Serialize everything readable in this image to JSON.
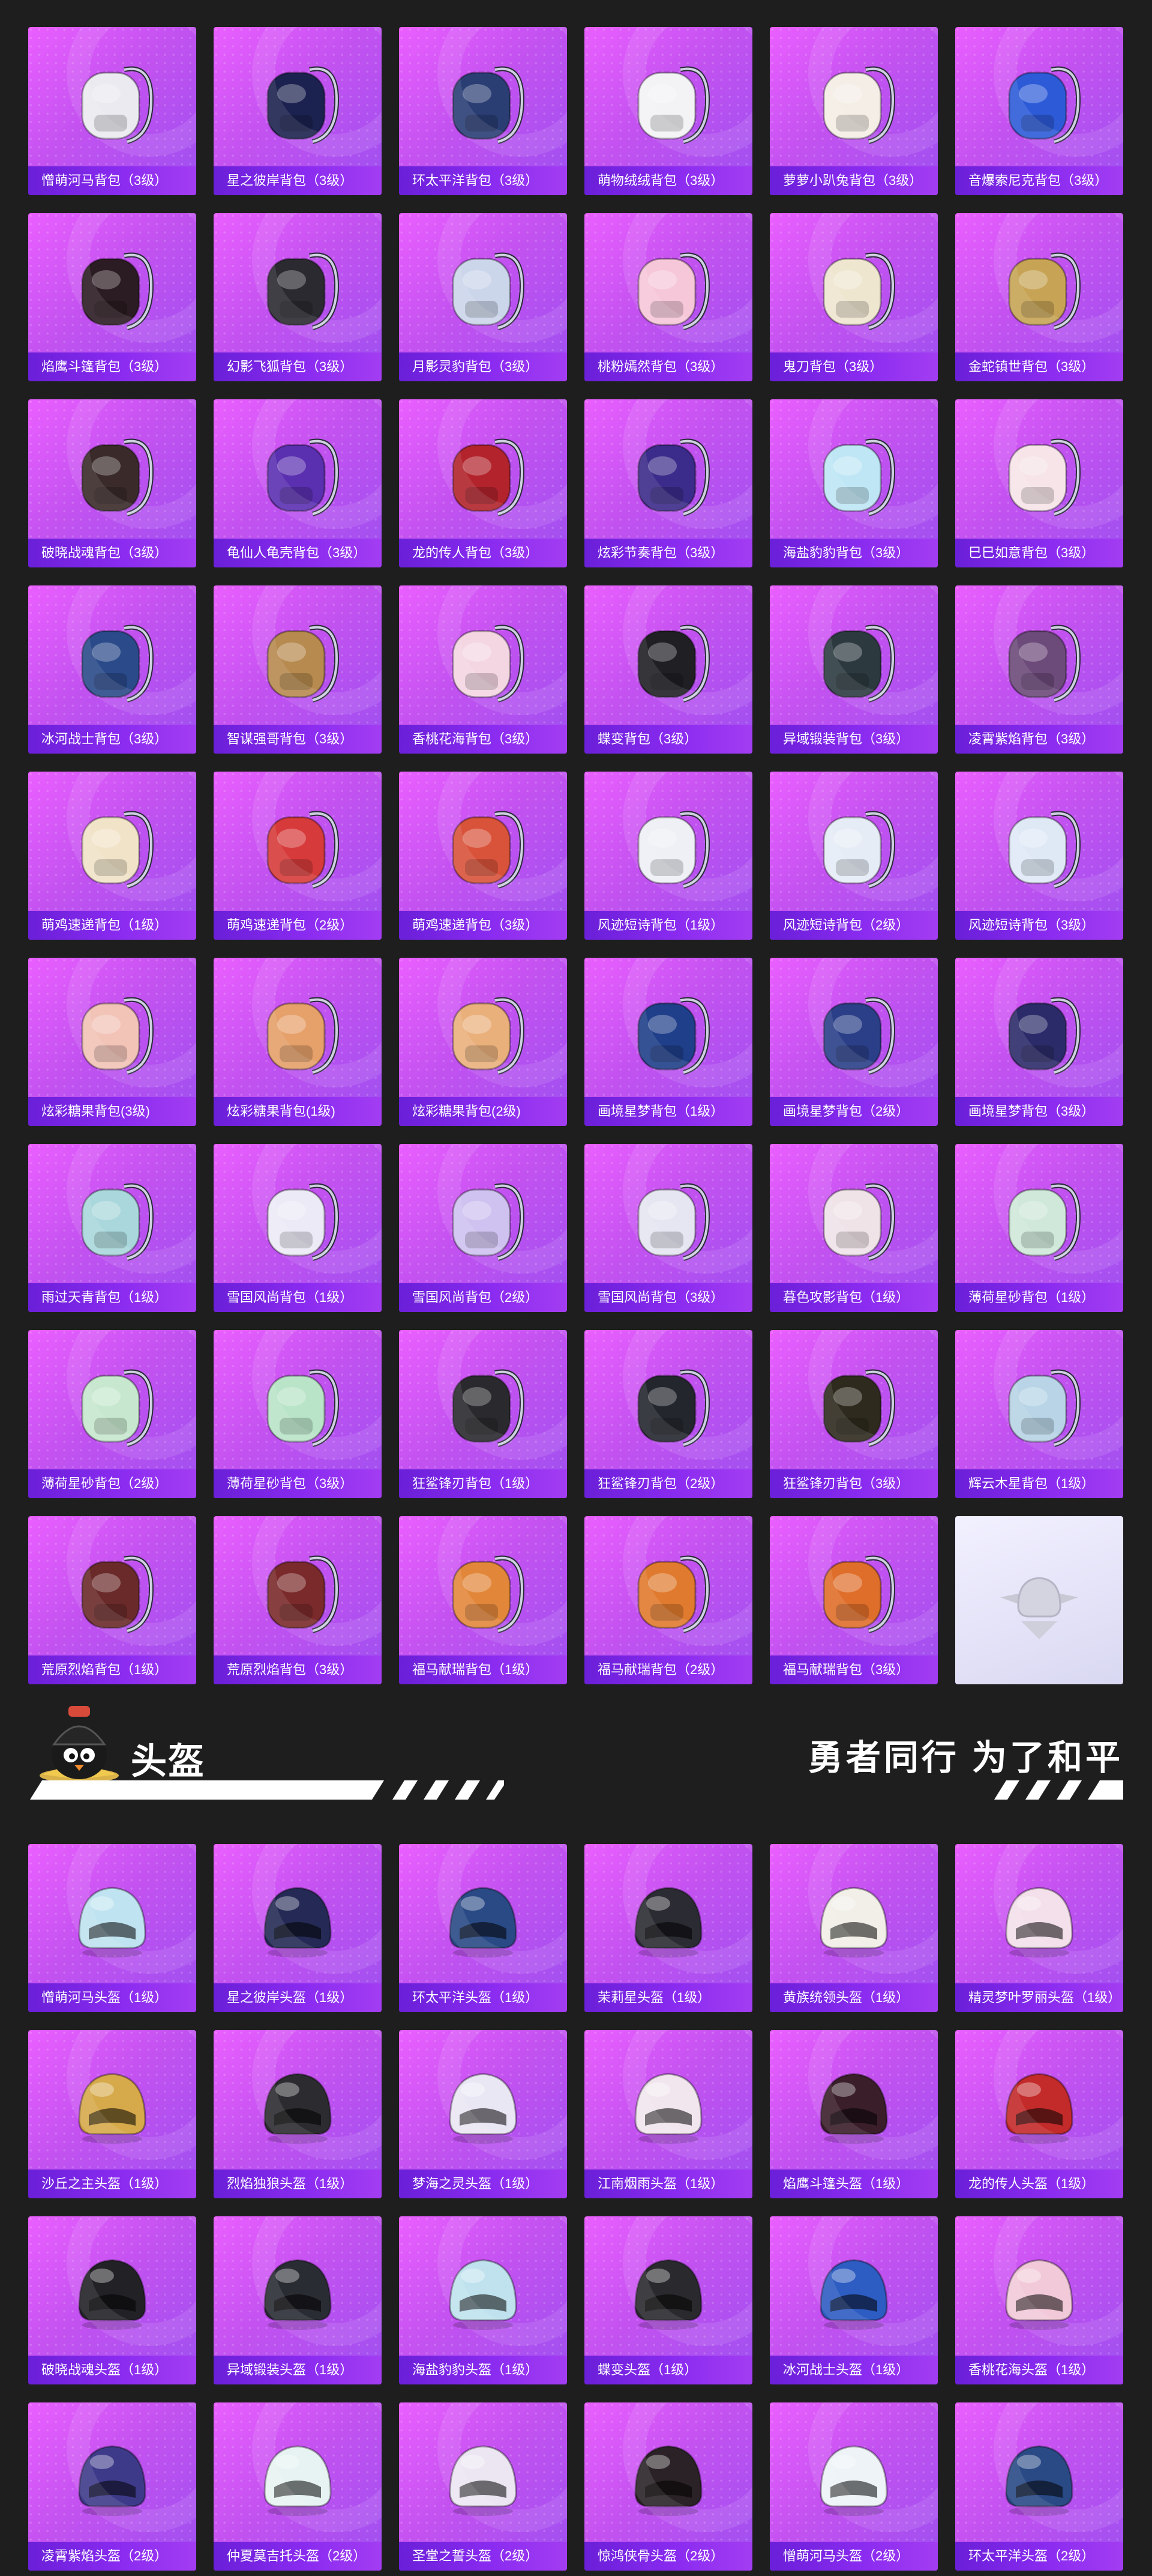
{
  "backpacks": [
    {
      "label": "憎萌河马背包（3级）",
      "icon": "hippo-backpack-icon",
      "color": "#eaeaf0"
    },
    {
      "label": "星之彼岸背包（3级）",
      "icon": "starship-backpack-icon",
      "color": "#1c2250"
    },
    {
      "label": "环太平洋背包（3级）",
      "icon": "mech-backpack-icon",
      "color": "#2a3e74"
    },
    {
      "label": "萌物绒绒背包（3级）",
      "icon": "plush-backpack-icon",
      "color": "#f3f3f6"
    },
    {
      "label": "萝萝小趴兔背包（3级）",
      "icon": "bunny-backpack-icon",
      "color": "#f4eee6"
    },
    {
      "label": "音爆索尼克背包（3级）",
      "icon": "sonic-backpack-icon",
      "color": "#2d5bd8"
    },
    {
      "label": "焰鹰斗篷背包（3级）",
      "icon": "flame-cloak-backpack-icon",
      "color": "#2b1b22"
    },
    {
      "label": "幻影飞狐背包（3级）",
      "icon": "phantom-fox-backpack-icon",
      "color": "#2a2a30"
    },
    {
      "label": "月影灵豹背包（3级）",
      "icon": "moon-leopard-backpack-icon",
      "color": "#cbd6ea"
    },
    {
      "label": "桃粉嫣然背包（3级）",
      "icon": "peach-backpack-icon",
      "color": "#f6c7d8"
    },
    {
      "label": "鬼刀背包（3级）",
      "icon": "ghost-blade-backpack-icon",
      "color": "#efe6d0"
    },
    {
      "label": "金蛇镇世背包（3级）",
      "icon": "golden-snake-backpack-icon",
      "color": "#c7a455"
    },
    {
      "label": "破晓战魂背包（3级）",
      "icon": "dawn-warrior-backpack-icon",
      "color": "#3a2a2a"
    },
    {
      "label": "龟仙人龟壳背包（3级）",
      "icon": "turtle-shell-backpack-icon",
      "color": "#5a2fb0"
    },
    {
      "label": "龙的传人背包（3级）",
      "icon": "dragon-heir-backpack-icon",
      "color": "#b2232c"
    },
    {
      "label": "炫彩节奏背包（3级）",
      "icon": "rhythm-backpack-icon",
      "color": "#3b2b8a"
    },
    {
      "label": "海盐豹豹背包（3级）",
      "icon": "sea-salt-backpack-icon",
      "color": "#bfe6f5"
    },
    {
      "label": "巳巳如意背包（3级）",
      "icon": "snake-ruyi-backpack-icon",
      "color": "#f6e4e8"
    },
    {
      "label": "冰河战士背包（3级）",
      "icon": "glacier-warrior-backpack-icon",
      "color": "#2a4a8a"
    },
    {
      "label": "智谋强哥背包（3级）",
      "icon": "strategist-backpack-icon",
      "color": "#b78a4f"
    },
    {
      "label": "香桃花海背包（3级）",
      "icon": "peach-blossom-backpack-icon",
      "color": "#f4d6e2"
    },
    {
      "label": "蝶变背包（3级）",
      "icon": "butterfly-backpack-icon",
      "color": "#1f1f24"
    },
    {
      "label": "异域锻装背包（3级）",
      "icon": "exotic-armor-backpack-icon",
      "color": "#2c3a40"
    },
    {
      "label": "凌霄紫焰背包（3级）",
      "icon": "violet-flame-backpack-icon",
      "color": "#6c4a7a"
    },
    {
      "label": "萌鸡速递背包（1级）",
      "icon": "chick-courier-backpack-icon",
      "color": "#f1e3c8"
    },
    {
      "label": "萌鸡速递背包（2级）",
      "icon": "chick-courier-backpack-icon",
      "color": "#d73a3a"
    },
    {
      "label": "萌鸡速递背包（3级）",
      "icon": "chick-courier-backpack-icon",
      "color": "#d9533a"
    },
    {
      "label": "风迹短诗背包（1级）",
      "icon": "wind-poem-backpack-icon",
      "color": "#eef0f6"
    },
    {
      "label": "风迹短诗背包（2级）",
      "icon": "wind-poem-backpack-icon",
      "color": "#e6ecf6"
    },
    {
      "label": "风迹短诗背包（3级）",
      "icon": "wind-poem-backpack-icon",
      "color": "#dfe9f6"
    },
    {
      "label": "炫彩糖果背包(3级)",
      "icon": "candy-backpack-icon",
      "color": "#f2c3b7"
    },
    {
      "label": "炫彩糖果背包(1级)",
      "icon": "candy-backpack-icon",
      "color": "#e6a06a"
    },
    {
      "label": "炫彩糖果背包(2级)",
      "icon": "candy-backpack-icon",
      "color": "#eab07c"
    },
    {
      "label": "画境星梦背包（1级）",
      "icon": "starry-dream-backpack-icon",
      "color": "#1f3f8a"
    },
    {
      "label": "画境星梦背包（2级）",
      "icon": "starry-dream-backpack-icon",
      "color": "#2a3f88"
    },
    {
      "label": "画境星梦背包（3级）",
      "icon": "starry-dream-backpack-icon",
      "color": "#2c2b6a"
    },
    {
      "label": "雨过天青背包（1级）",
      "icon": "sky-blue-backpack-icon",
      "color": "#a9d7dc"
    },
    {
      "label": "雪国风尚背包（1级）",
      "icon": "snow-style-backpack-icon",
      "color": "#eceaf6"
    },
    {
      "label": "雪国风尚背包（2级）",
      "icon": "snow-style-backpack-icon",
      "color": "#cfc2f0"
    },
    {
      "label": "雪国风尚背包（3级）",
      "icon": "snow-style-backpack-icon",
      "color": "#e6e6f2"
    },
    {
      "label": "暮色攻影背包（1级）",
      "icon": "dusk-bat-backpack-icon",
      "color": "#efe3e8"
    },
    {
      "label": "薄荷星砂背包（1级）",
      "icon": "mint-sand-backpack-icon",
      "color": "#cfe8da"
    },
    {
      "label": "薄荷星砂背包（2级）",
      "icon": "mint-sand-backpack-icon",
      "color": "#c7e8cf"
    },
    {
      "label": "薄荷星砂背包（3级）",
      "icon": "mint-sand-backpack-icon",
      "color": "#b9e4c8"
    },
    {
      "label": "狂鲨锋刃背包（1级）",
      "icon": "shark-blade-backpack-icon",
      "color": "#2a2a2e"
    },
    {
      "label": "狂鲨锋刃背包（2级）",
      "icon": "shark-blade-backpack-icon",
      "color": "#24262e"
    },
    {
      "label": "狂鲨锋刃背包（3级）",
      "icon": "shark-blade-backpack-icon",
      "color": "#2e2a1e"
    },
    {
      "label": "辉云木星背包（1级）",
      "icon": "cloud-jupiter-backpack-icon",
      "color": "#b8d4e6"
    },
    {
      "label": "荒原烈焰背包（1级）",
      "icon": "wasteland-flame-backpack-icon",
      "color": "#6a2a2a"
    },
    {
      "label": "荒原烈焰背包（3级）",
      "icon": "wasteland-flame-backpack-icon",
      "color": "#7a2a2a"
    },
    {
      "label": "福马献瑞背包（1级）",
      "icon": "lucky-horse-backpack-icon",
      "color": "#e2873a"
    },
    {
      "label": "福马献瑞背包（2级）",
      "icon": "lucky-horse-backpack-icon",
      "color": "#e07a2e"
    },
    {
      "label": "福马献瑞背包（3级）",
      "icon": "lucky-horse-backpack-icon",
      "color": "#df6e2a"
    }
  ],
  "placeholder_icon": "winged-helmet-emblem-icon",
  "section": {
    "title": "头盔",
    "slogan": "勇者同行 为了和平",
    "mascot_icon": "chick-mascot-icon"
  },
  "helmets": [
    {
      "label": "憎萌河马头盔（1级）",
      "icon": "hippo-helmet-icon",
      "color": "#bfe3f0"
    },
    {
      "label": "星之彼岸头盔（1级）",
      "icon": "starship-helmet-icon",
      "color": "#242a55"
    },
    {
      "label": "环太平洋头盔（1级）",
      "icon": "mech-helmet-icon",
      "color": "#2a4a86"
    },
    {
      "label": "茉莉星头盔（1级）",
      "icon": "jasmine-star-helmet-icon",
      "color": "#2b2b33"
    },
    {
      "label": "黄族统领头盔（1级）",
      "icon": "yellow-clan-helmet-icon",
      "color": "#f2efe8"
    },
    {
      "label": "精灵梦叶罗丽头盔（1级）",
      "icon": "fairy-dream-helmet-icon",
      "color": "#f3e0ea"
    },
    {
      "label": "沙丘之主头盔（1级）",
      "icon": "dune-lord-helmet-icon",
      "color": "#d6a94a"
    },
    {
      "label": "烈焰独狼头盔（1级）",
      "icon": "flame-wolf-helmet-icon",
      "color": "#2c2c30"
    },
    {
      "label": "梦海之灵头盔（1级）",
      "icon": "dream-sea-helmet-icon",
      "color": "#eae7f4"
    },
    {
      "label": "江南烟雨头盔（1级）",
      "icon": "jiangnan-rain-helmet-icon",
      "color": "#f1e6ee"
    },
    {
      "label": "焰鹰斗篷头盔（1级）",
      "icon": "flame-cloak-helmet-icon",
      "color": "#3a1e2a"
    },
    {
      "label": "龙的传人头盔（1级）",
      "icon": "dragon-heir-helmet-icon",
      "color": "#c32a2a"
    },
    {
      "label": "破晓战魂头盔（1级）",
      "icon": "dawn-warrior-helmet-icon",
      "color": "#222226"
    },
    {
      "label": "异域锻装头盔（1级）",
      "icon": "exotic-armor-helmet-icon",
      "color": "#2a2c34"
    },
    {
      "label": "海盐豹豹头盔（1级）",
      "icon": "sea-salt-helmet-icon",
      "color": "#bfe2ee"
    },
    {
      "label": "蝶变头盔（1级）",
      "icon": "butterfly-helmet-icon",
      "color": "#2a2a2e"
    },
    {
      "label": "冰河战士头盔（1级）",
      "icon": "glacier-warrior-helmet-icon",
      "color": "#2d5cc2"
    },
    {
      "label": "香桃花海头盔（1级）",
      "icon": "peach-blossom-helmet-icon",
      "color": "#f2c9d8"
    },
    {
      "label": "凌霄紫焰头盔（2级）",
      "icon": "violet-flame-helmet-icon",
      "color": "#3e3a8a"
    },
    {
      "label": "仲夏莫吉托头盔（2级）",
      "icon": "midsummer-mojito-helmet-icon",
      "color": "#e7f3f2"
    },
    {
      "label": "圣堂之誓头盔（2级）",
      "icon": "templar-oath-helmet-icon",
      "color": "#ebe6f2"
    },
    {
      "label": "惊鸿侠骨头盔（2级）",
      "icon": "wandering-knight-helmet-icon",
      "color": "#2a2226"
    },
    {
      "label": "憎萌河马头盔（2级）",
      "icon": "hippo-helmet-icon",
      "color": "#eef3f8"
    },
    {
      "label": "环太平洋头盔（2级）",
      "icon": "mech-helmet-icon",
      "color": "#2a4a86"
    }
  ]
}
